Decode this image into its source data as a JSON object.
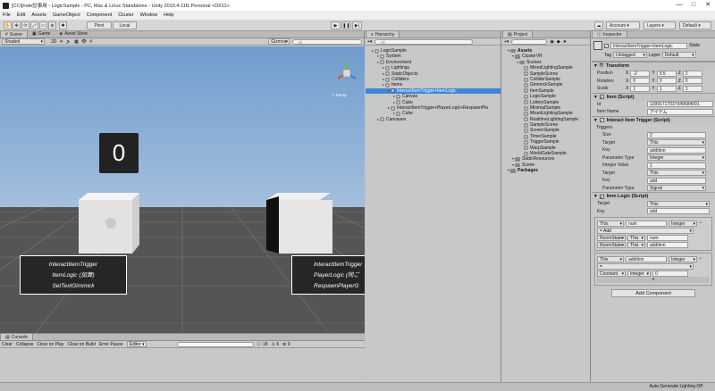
{
  "window": {
    "title": "[CCI]note記事用 - LogicSample - PC, Mac & Linux Standalone - Unity 2019.4.11f1 Personal <DX11>",
    "controls": [
      "—",
      "□",
      "✕"
    ]
  },
  "menu": [
    "File",
    "Edit",
    "Assets",
    "GameObject",
    "Component",
    "Cluster",
    "Window",
    "Help"
  ],
  "toolbar": {
    "pivot": "Pivot",
    "local": "Local",
    "account": "Account",
    "layers": "Layers",
    "layout": "Default"
  },
  "scene_panel": {
    "tabs": [
      "Scene",
      "Game",
      "Asset Store"
    ],
    "shading": "Shaded",
    "mode": "2D",
    "gizmos": "Gizmos",
    "search_placeholder": "All",
    "counter_text": "0",
    "gizmo_label": "< Persp",
    "label_left": [
      "InteractItemTrigger",
      "ItemLogic (加算)",
      "SetTextGimmick"
    ],
    "label_right": [
      "InteractItemTrigger",
      "PlayerLogic (同ご",
      "RespawnPlayerG"
    ]
  },
  "hierarchy": {
    "tab": "Hierarchy",
    "create": "Create",
    "search_placeholder": "All",
    "items": [
      {
        "label": "LogicSample",
        "indent": 1,
        "icon": "unity-scene-icon"
      },
      {
        "label": "System",
        "indent": 2,
        "icon": "cube-icon"
      },
      {
        "label": "Environment",
        "indent": 2,
        "icon": "cube-icon"
      },
      {
        "label": "Lightings",
        "indent": 3,
        "icon": "cube-icon"
      },
      {
        "label": "StaticObjects",
        "indent": 3,
        "icon": "cube-icon"
      },
      {
        "label": "Colliders",
        "indent": 3,
        "icon": "cube-icon"
      },
      {
        "label": "Items",
        "indent": 3,
        "icon": "cube-icon"
      },
      {
        "label": "InteractItemTrigger+ItemLogic",
        "indent": 4,
        "icon": "cube-icon",
        "selected": true
      },
      {
        "label": "Canvas",
        "indent": 5,
        "icon": "cube-icon"
      },
      {
        "label": "Cube",
        "indent": 5,
        "icon": "cube-icon"
      },
      {
        "label": "InteractItemTrigger+PlayerLogic+RespawnPla",
        "indent": 4,
        "icon": "cube-icon"
      },
      {
        "label": "Cube",
        "indent": 5,
        "icon": "cube-icon"
      },
      {
        "label": "Canvases",
        "indent": 2,
        "icon": "cube-icon"
      }
    ]
  },
  "project": {
    "tab": "Project",
    "create": "Create",
    "items": [
      {
        "label": "Assets",
        "indent": 1,
        "bold": true
      },
      {
        "label": "ClusterVR",
        "indent": 2
      },
      {
        "label": "Scenes",
        "indent": 3
      },
      {
        "label": "MixedLightingSample",
        "indent": 4
      },
      {
        "label": "SampleScene",
        "indent": 4
      },
      {
        "label": "ColliderSample",
        "indent": 4
      },
      {
        "label": "GimmickSample",
        "indent": 4
      },
      {
        "label": "ItemSample",
        "indent": 4
      },
      {
        "label": "LogicSample",
        "indent": 4
      },
      {
        "label": "LotterySample",
        "indent": 4
      },
      {
        "label": "MinimalSample",
        "indent": 4
      },
      {
        "label": "MixedLightingSample",
        "indent": 4
      },
      {
        "label": "RealtimeLightingSample",
        "indent": 4
      },
      {
        "label": "SampleScene",
        "indent": 4
      },
      {
        "label": "ScreenSample",
        "indent": 4
      },
      {
        "label": "TimerSample",
        "indent": 4
      },
      {
        "label": "TriggerSample",
        "indent": 4
      },
      {
        "label": "WarpSample",
        "indent": 4
      },
      {
        "label": "WorldGateSample",
        "indent": 4
      },
      {
        "label": "StaticResources",
        "indent": 2
      },
      {
        "label": "Scene",
        "indent": 2
      },
      {
        "label": "Packages",
        "indent": 1,
        "bold": true
      }
    ]
  },
  "inspector": {
    "tab": "Inspector",
    "object_name": "InteractItemTrigger+ItemLogic",
    "static_label": "Static",
    "tag_label": "Tag",
    "tag_value": "Untagged",
    "layer_label": "Layer",
    "layer_value": "Default",
    "transform": {
      "title": "Transform",
      "rows": [
        {
          "label": "Position",
          "x": "-2",
          "y": "0.5",
          "z": "2"
        },
        {
          "label": "Rotation",
          "x": "0",
          "y": "0",
          "z": "0"
        },
        {
          "label": "Scale",
          "x": "1",
          "y": "1",
          "z": "1"
        }
      ]
    },
    "item_script": {
      "title": "Item (Script)",
      "id_label": "Id",
      "id_value": "13991717037949684091",
      "name_label": "Item Name",
      "name_value": "アイテム"
    },
    "interact_trigger": {
      "title": "Interact Item Trigger (Script)",
      "triggers_label": "Triggers",
      "rows": [
        {
          "label": "Size",
          "value": "2",
          "type": "field"
        },
        {
          "label": "Target",
          "value": "This",
          "type": "drop"
        },
        {
          "label": "Key",
          "value": "addition",
          "type": "field"
        },
        {
          "label": "Parameter Type",
          "value": "Integer",
          "type": "drop"
        },
        {
          "label": "Integer Value",
          "value": "1",
          "type": "field"
        },
        {
          "label": "Target",
          "value": "This",
          "type": "drop"
        },
        {
          "label": "Key",
          "value": "add",
          "type": "field"
        },
        {
          "label": "Parameter Type",
          "value": "Signal",
          "type": "drop"
        }
      ]
    },
    "item_logic": {
      "title": "Item Logic (Script)",
      "target_label": "Target",
      "target_value": "This",
      "key_label": "Key",
      "key_value": "add",
      "statement1": {
        "target": "This",
        "key": "num",
        "type": "Integer"
      },
      "op1": "Add",
      "op1_rows": [
        {
          "a": "RoomState",
          "b": "This",
          "c": "num"
        },
        {
          "a": "RoomState",
          "b": "This",
          "c": "addition"
        }
      ],
      "statement2": {
        "target": "This",
        "key": "addition",
        "type": "Integer"
      },
      "op2": "=",
      "op2_row": {
        "a": "Constant",
        "b": "Integer",
        "c": "0"
      },
      "plus": "+"
    },
    "add_component": "Add Component"
  },
  "console": {
    "tab": "Console",
    "buttons": [
      "Clear",
      "Collapse",
      "Clear on Play",
      "Clear on Build",
      "Error Pause",
      "Editor"
    ],
    "counts": {
      "log": "18",
      "warn": "6",
      "error": "0"
    }
  },
  "statusbar": {
    "text": "Auto Generate Lighting Off"
  },
  "colors": {
    "selection": "#3d86d8",
    "sky": "#7ea8d8",
    "ground": "#5a5a5a"
  }
}
